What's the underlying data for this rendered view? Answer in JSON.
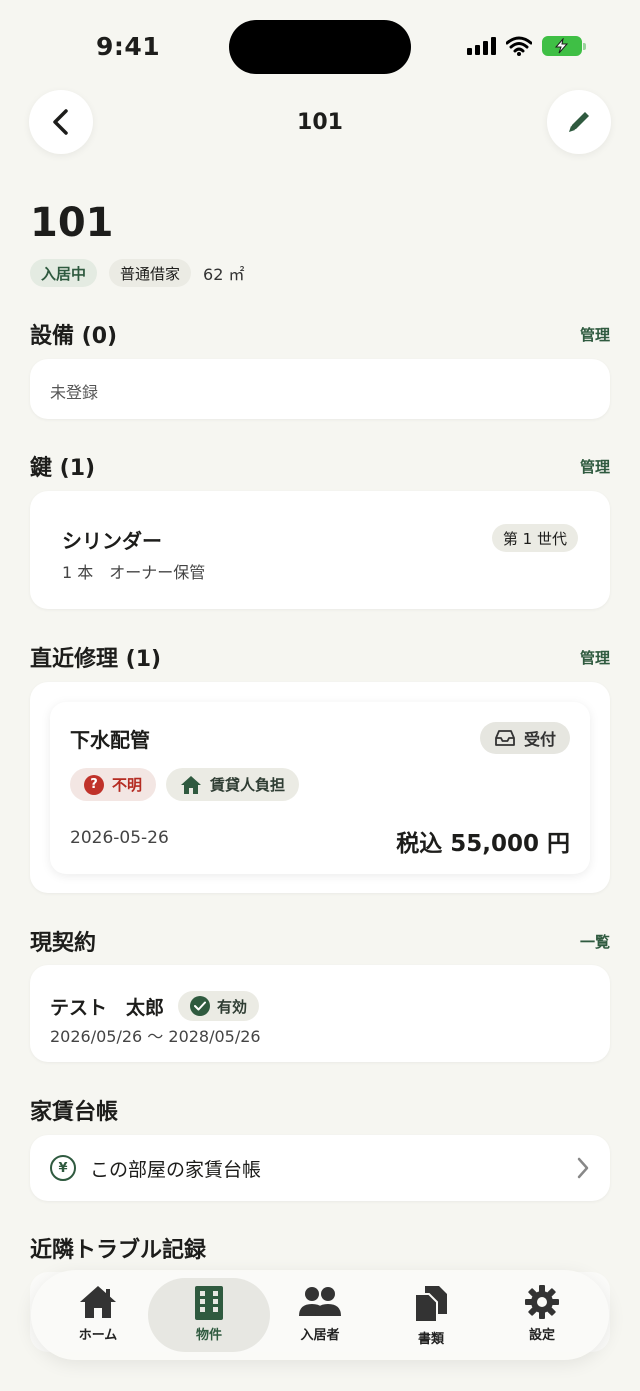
{
  "status_bar": {
    "time": "9:41"
  },
  "header": {
    "title": "101"
  },
  "room": {
    "title": "101",
    "status": "入居中",
    "contract_type": "普通借家",
    "area": "62 ㎡"
  },
  "equipment": {
    "title": "設備 (0)",
    "link": "管理",
    "empty": "未登録"
  },
  "keys": {
    "title": "鍵 (1)",
    "link": "管理",
    "item": {
      "name": "シリンダー",
      "detail": "1 本　オーナー保管",
      "generation": "第 1 世代"
    }
  },
  "repairs": {
    "title": "直近修理 (1)",
    "link": "管理",
    "item": {
      "title": "下水配管",
      "status": "受付",
      "cause": "不明",
      "burden": "賃貸人負担",
      "date": "2026-05-26",
      "price": "税込 55,000 円"
    }
  },
  "contract": {
    "title": "現契約",
    "link": "一覧",
    "tenant": "テスト　太郎",
    "badge": "有効",
    "period": "2026/05/26 〜 2028/05/26"
  },
  "rent_ledger": {
    "title": "家賃台帳",
    "row_label": "この部屋の家賃台帳",
    "icon": "¥"
  },
  "troubles": {
    "title": "近隣トラブル記録"
  },
  "tabs": [
    {
      "label": "ホーム"
    },
    {
      "label": "物件"
    },
    {
      "label": "入居者"
    },
    {
      "label": "書類"
    },
    {
      "label": "設定"
    }
  ],
  "colors": {
    "accent": "#2f5a3f",
    "danger": "#c0322a",
    "background": "#f6f6f1",
    "battery": "#3fbf45"
  }
}
